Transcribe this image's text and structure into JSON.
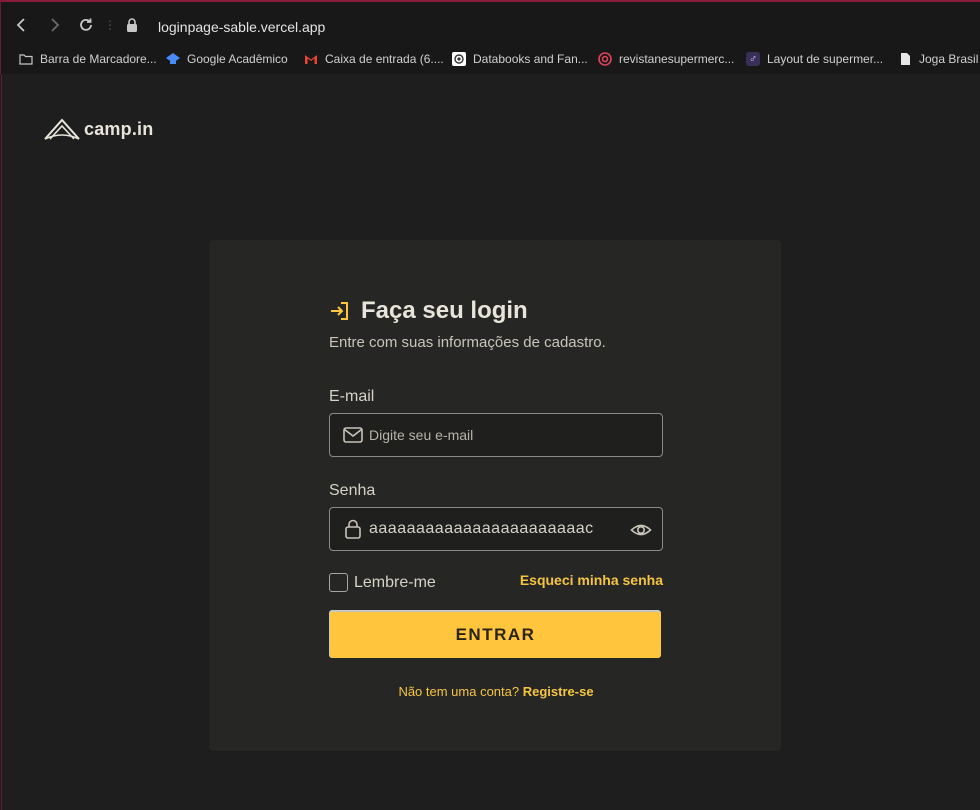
{
  "browser": {
    "url_host": "loginpage-sable.",
    "url_rest": "vercel.app",
    "bookmarks": [
      {
        "label": "Barra de Marcadore...",
        "icon": "folder-icon"
      },
      {
        "label": "Google Acadêmico",
        "icon": "google-scholar-icon"
      },
      {
        "label": "Caixa de entrada (6....",
        "icon": "gmail-icon"
      },
      {
        "label": "Databooks and Fan...",
        "icon": "databooks-icon"
      },
      {
        "label": "revistanesupermerc...",
        "icon": "target-icon"
      },
      {
        "label": "Layout de supermer...",
        "icon": "layout-icon"
      },
      {
        "label": "Joga Brasil -",
        "icon": "page-icon"
      }
    ]
  },
  "logo": {
    "text": "camp.in"
  },
  "login": {
    "title": "Faça seu login",
    "subtitle": "Entre com suas informações de cadastro.",
    "email_label": "E-mail",
    "email_placeholder": "Digite seu e-mail",
    "password_label": "Senha",
    "password_value": "aaaaaaaaaaaaaaaaaaaaaaac",
    "remember_label": "Lembre-me",
    "forgot_label": "Esqueci minha senha",
    "submit_label": "ENTRAR",
    "signup_prompt": "Não tem uma conta?",
    "signup_link": "Registre-se"
  },
  "colors": {
    "accent": "#ffc53d",
    "card": "#262624",
    "background": "#1e1e1e"
  }
}
